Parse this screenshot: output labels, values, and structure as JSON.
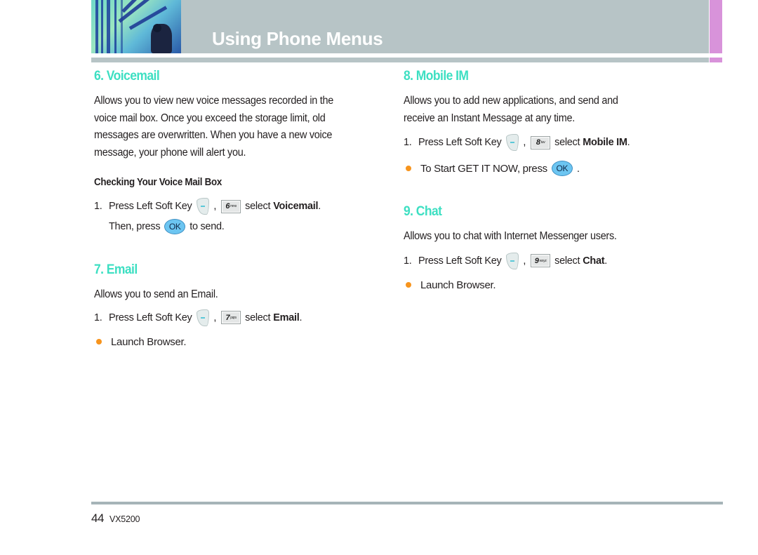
{
  "header": {
    "title": "Using Phone Menus",
    "accent_color": "#d893da",
    "bar_color": "#b7c4c6"
  },
  "sections": {
    "voicemail": {
      "title": "6. Voicemail",
      "body": [
        "Allows you to view new voice messages recorded in the",
        "voice mail box. Once you exceed the storage limit, old",
        "messages are overwritten. When you have a new voice",
        "message, your phone will alert you."
      ],
      "subheading": "Checking Your Voice Mail Box",
      "step1": {
        "num": "1.",
        "text": "Press Left Soft Key",
        "comma": ",",
        "key": "6",
        "key_letters": "mno",
        "select": "select",
        "target": "Voicemail",
        "period": "."
      },
      "step1b": {
        "then": "Then, press",
        "ok": "OK",
        "after": "to send."
      }
    },
    "email": {
      "title": "7. Email",
      "body": "Allows you to send an Email.",
      "step1": {
        "num": "1.",
        "text": "Press Left Soft Key",
        "comma": ",",
        "key": "7",
        "key_letters": "pqrs",
        "select": "select",
        "target": "Email",
        "period": "."
      },
      "bullet": "Launch Browser."
    },
    "mobile_im": {
      "title": "8. Mobile IM",
      "body": [
        "Allows you to add new applications, and send and",
        "receive an Instant Message at any time."
      ],
      "step1": {
        "num": "1.",
        "text": "Press Left Soft Key",
        "comma": ",",
        "key": "8",
        "key_letters": "tuv",
        "select": "select",
        "target": "Mobile IM",
        "period": "."
      },
      "bullet": {
        "text": "To Start GET IT NOW, press",
        "ok": "OK",
        "after": "."
      }
    },
    "chat": {
      "title": "9. Chat",
      "body": "Allows you to chat with Internet Messenger users.",
      "step1": {
        "num": "1.",
        "text": "Press Left Soft Key",
        "comma": ",",
        "key": "9",
        "key_letters": "wxyz",
        "select": "select",
        "target": "Chat",
        "period": "."
      },
      "bullet": "Launch Browser."
    }
  },
  "colors": {
    "section_title": "#3ddfc2",
    "bullet": "#f7941d",
    "ok_key": "#6cc5f1"
  },
  "footer": {
    "page_number": "44",
    "model": "VX5200"
  }
}
